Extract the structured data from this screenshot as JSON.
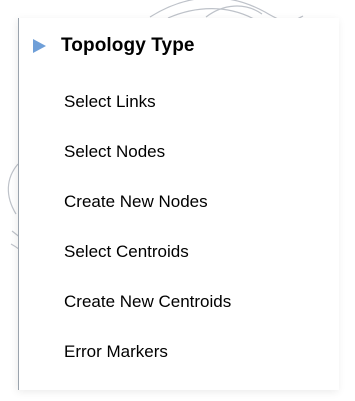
{
  "menu": {
    "header": "Topology Type",
    "items": [
      {
        "label": "Select Links"
      },
      {
        "label": "Select Nodes"
      },
      {
        "label": "Create New Nodes"
      },
      {
        "label": "Select Centroids"
      },
      {
        "label": "Create New Centroids"
      },
      {
        "label": "Error Markers"
      }
    ],
    "header_icon": "triangle-right-icon",
    "accent_color": "#6f9fd8"
  }
}
